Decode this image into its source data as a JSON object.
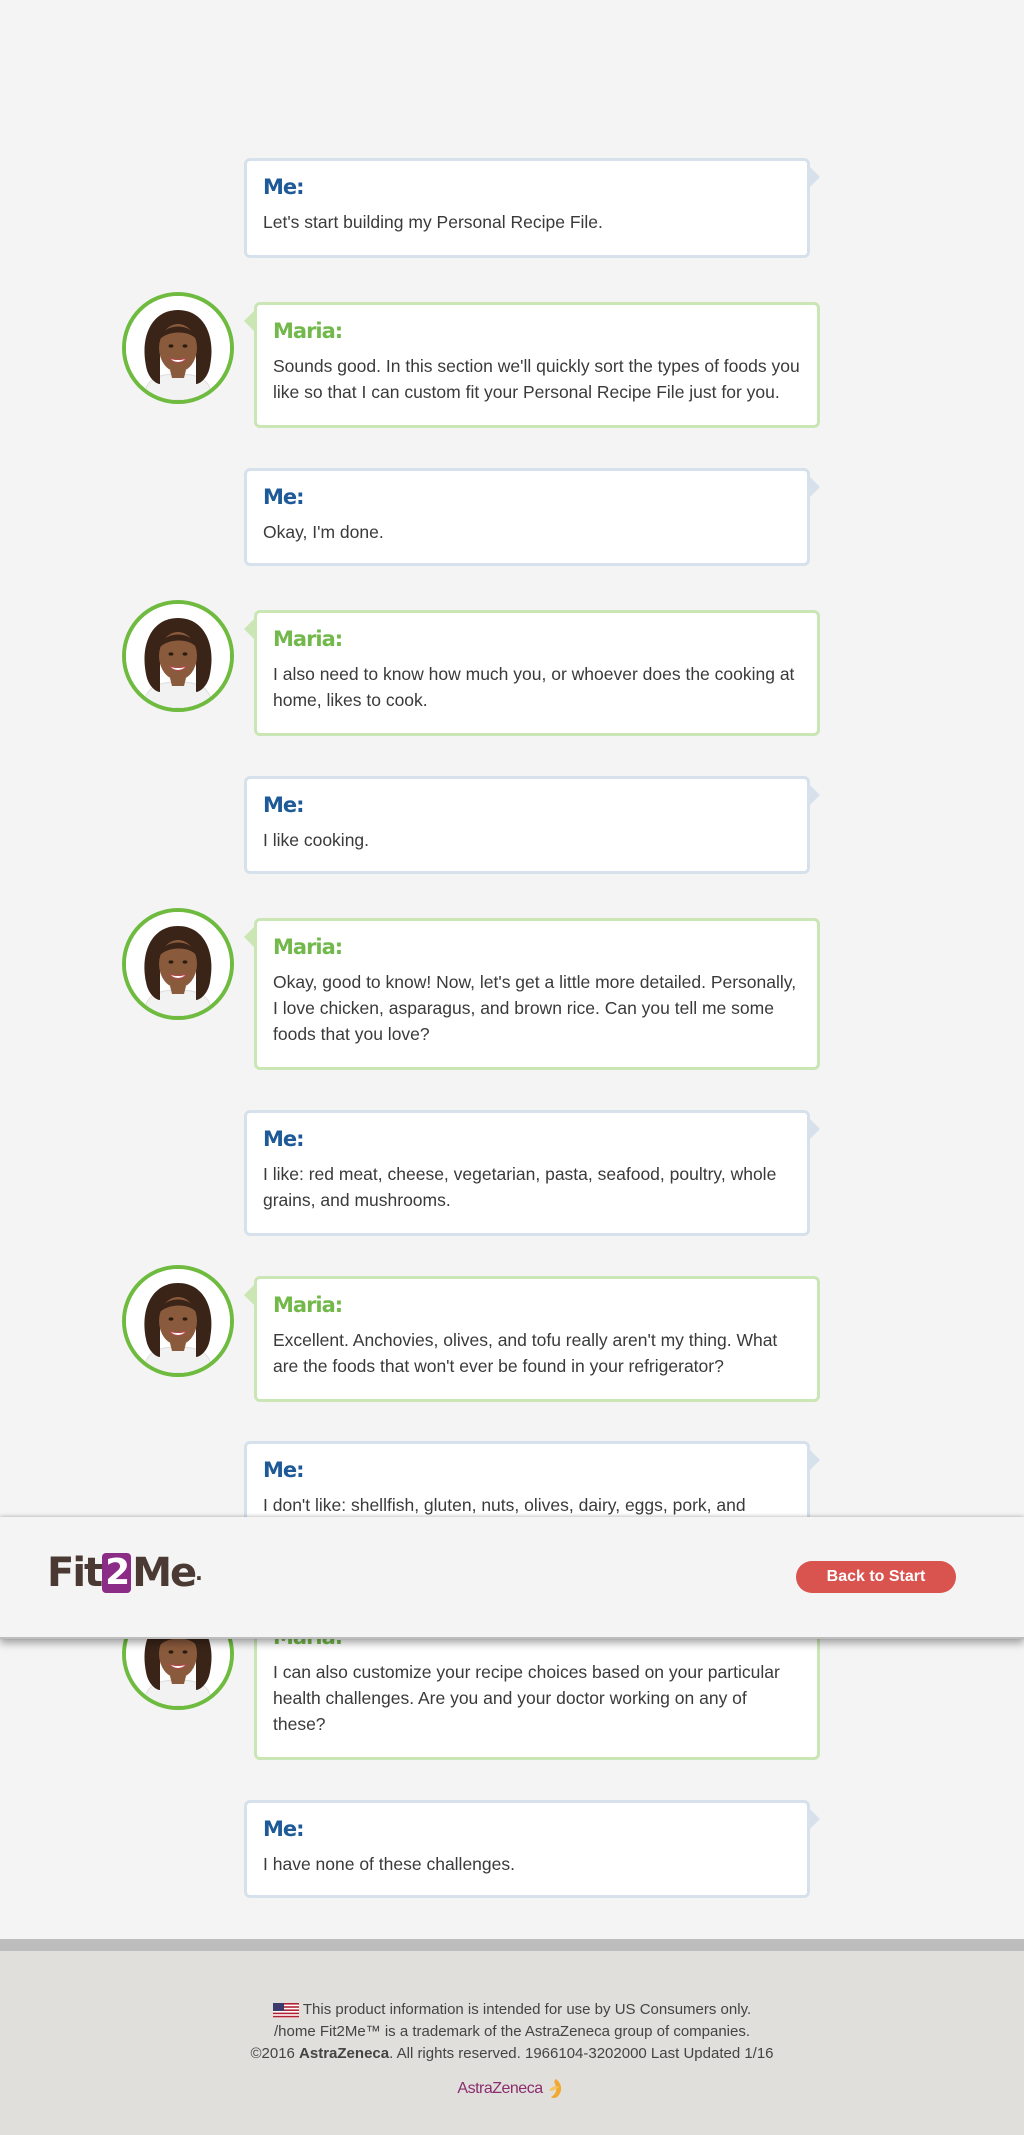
{
  "chat": {
    "m1": {
      "speaker": "Me:",
      "text": "Let's start building my Personal Recipe File."
    },
    "m2": {
      "speaker": "Maria:",
      "text": "Sounds good. In this section we'll quickly sort the types of foods you like so that I can custom fit your Personal Recipe File just for you."
    },
    "m3": {
      "speaker": "Me:",
      "text": "Okay, I'm done."
    },
    "m4": {
      "speaker": "Maria:",
      "text": "I also need to know how much you, or whoever does the cooking at home, likes to cook."
    },
    "m5": {
      "speaker": "Me:",
      "text": "I like cooking."
    },
    "m6": {
      "speaker": "Maria:",
      "text": "Okay, good to know! Now, let's get a little more detailed. Personally, I love chicken, asparagus, and brown rice. Can you tell me some foods that you love?"
    },
    "m7": {
      "speaker": "Me:",
      "text": "I like: red meat, cheese, vegetarian, pasta, seafood, poultry, whole grains, and mushrooms."
    },
    "m8": {
      "speaker": "Maria:",
      "text": "Excellent. Anchovies, olives, and tofu really aren't my thing. What are the foods that won't ever be found in your refrigerator?"
    },
    "m9": {
      "speaker": "Me:",
      "text": "I don't like: shellfish, gluten, nuts, olives, dairy, eggs, pork, and green"
    },
    "m10": {
      "speaker": "Maria:",
      "text": "I can also customize your recipe choices based on your particular health challenges. Are you and your doctor working on any of these?"
    },
    "m11": {
      "speaker": "Me:",
      "text": "I have none of these challenges."
    }
  },
  "app_bar": {
    "logo": {
      "part1": "Fit",
      "part2": "2",
      "part3": "Me",
      "suffix": "."
    },
    "back_button": "Back to Start"
  },
  "footer": {
    "line1": "This product information is intended for use by US Consumers only.",
    "line2": "/home Fit2Me™ is a trademark of the AstraZeneca group of companies.",
    "line3_prefix": "©2016",
    "line3_brand": "AstraZeneca",
    "line3_rest": ". All rights reserved. 1966104-3202000 Last Updated 1/16",
    "company_logo": "AstraZeneca"
  },
  "colors": {
    "me_speaker": "#1e5a98",
    "maria_speaker": "#72b84a",
    "button": "#d9534f",
    "logo_accent": "#8b2d87"
  },
  "icons": [
    "avatar-maria",
    "us-flag-icon",
    "astrazeneca-logo-icon"
  ]
}
